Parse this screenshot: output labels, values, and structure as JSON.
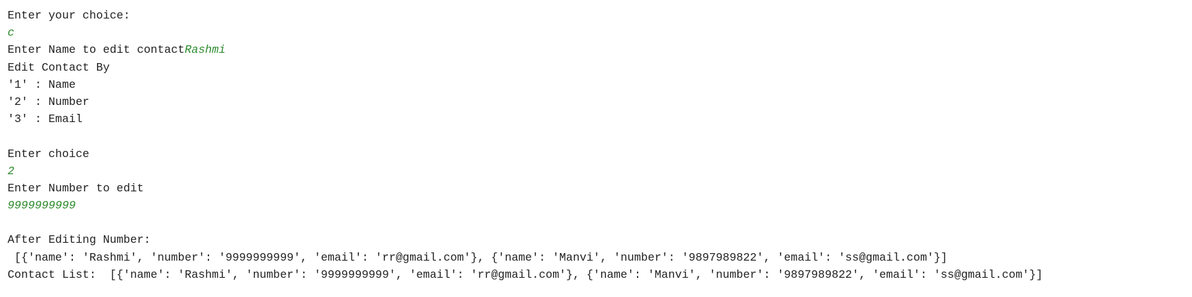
{
  "console": {
    "prompt_choice": "Enter your choice:",
    "input_choice": "c",
    "prompt_name": "Enter Name to edit contact",
    "input_name": "Rashmi",
    "edit_by": "Edit Contact By",
    "option_1": "'1' : Name",
    "option_2": "'2' : Number",
    "option_3": "'3' : Email",
    "prompt_enter_choice": "Enter choice",
    "input_enter_choice": "2",
    "prompt_number": "Enter Number to edit",
    "input_number": "9999999999",
    "after_editing_label": "After Editing Number:",
    "after_editing_value": " [{'name': 'Rashmi', 'number': '9999999999', 'email': 'rr@gmail.com'}, {'name': 'Manvi', 'number': '9897989822', 'email': 'ss@gmail.com'}]",
    "contact_list": "Contact List:  [{'name': 'Rashmi', 'number': '9999999999', 'email': 'rr@gmail.com'}, {'name': 'Manvi', 'number': '9897989822', 'email': 'ss@gmail.com'}]"
  },
  "colors": {
    "output_text": "#222222",
    "user_input": "#2e8b2e",
    "background": "#ffffff"
  }
}
